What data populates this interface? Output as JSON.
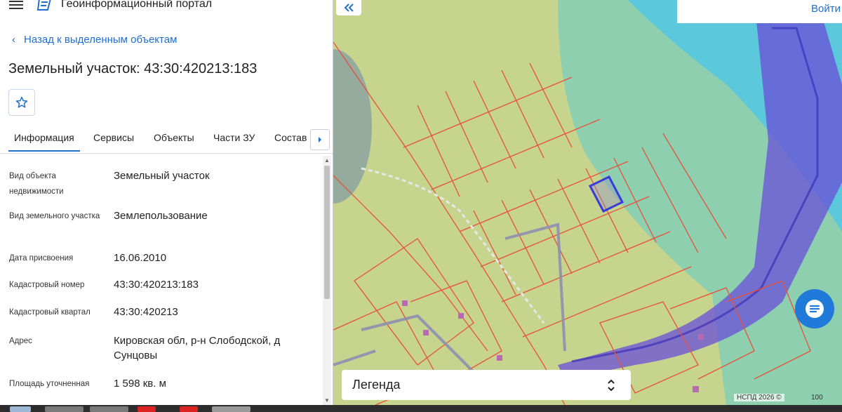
{
  "header": {
    "app_title": "Геоинформационный портал"
  },
  "nav": {
    "back_label": "Назад к выделенным объектам"
  },
  "object": {
    "title": "Земельный участок: 43:30:420213:183"
  },
  "tabs": [
    {
      "label": "Информация",
      "active": true
    },
    {
      "label": "Сервисы"
    },
    {
      "label": "Объекты"
    },
    {
      "label": "Части ЗУ"
    },
    {
      "label": "Состав"
    }
  ],
  "info": [
    {
      "label": "Вид объекта недвижимости",
      "value": "Земельный участок"
    },
    {
      "label": "Вид земельного участка",
      "value": "Землепользование"
    },
    {
      "label": "Дата присвоения",
      "value": "16.06.2010"
    },
    {
      "label": "Кадастровый номер",
      "value": "43:30:420213:183"
    },
    {
      "label": "Кадастровый квартал",
      "value": "43:30:420213"
    },
    {
      "label": "Адрес",
      "value": "Кировская обл, р-н Слободской, д Сунцовы"
    },
    {
      "label": "Площадь уточненная",
      "value": "1 598 кв. м"
    }
  ],
  "map": {
    "login_label": "Войти",
    "legend_label": "Легенда",
    "attribution": "НСПД 2026 ©",
    "scale_label": "100"
  },
  "colors": {
    "accent": "#1f6fd1",
    "parcel_line": "#e8503a",
    "highlight": "#3a3ad6"
  },
  "icons": [
    "menu-icon",
    "portal-logo-icon",
    "chevron-left-icon",
    "star-icon",
    "chevron-right-icon",
    "double-chevron-left-icon",
    "chat-icon",
    "sort-arrows-icon"
  ]
}
